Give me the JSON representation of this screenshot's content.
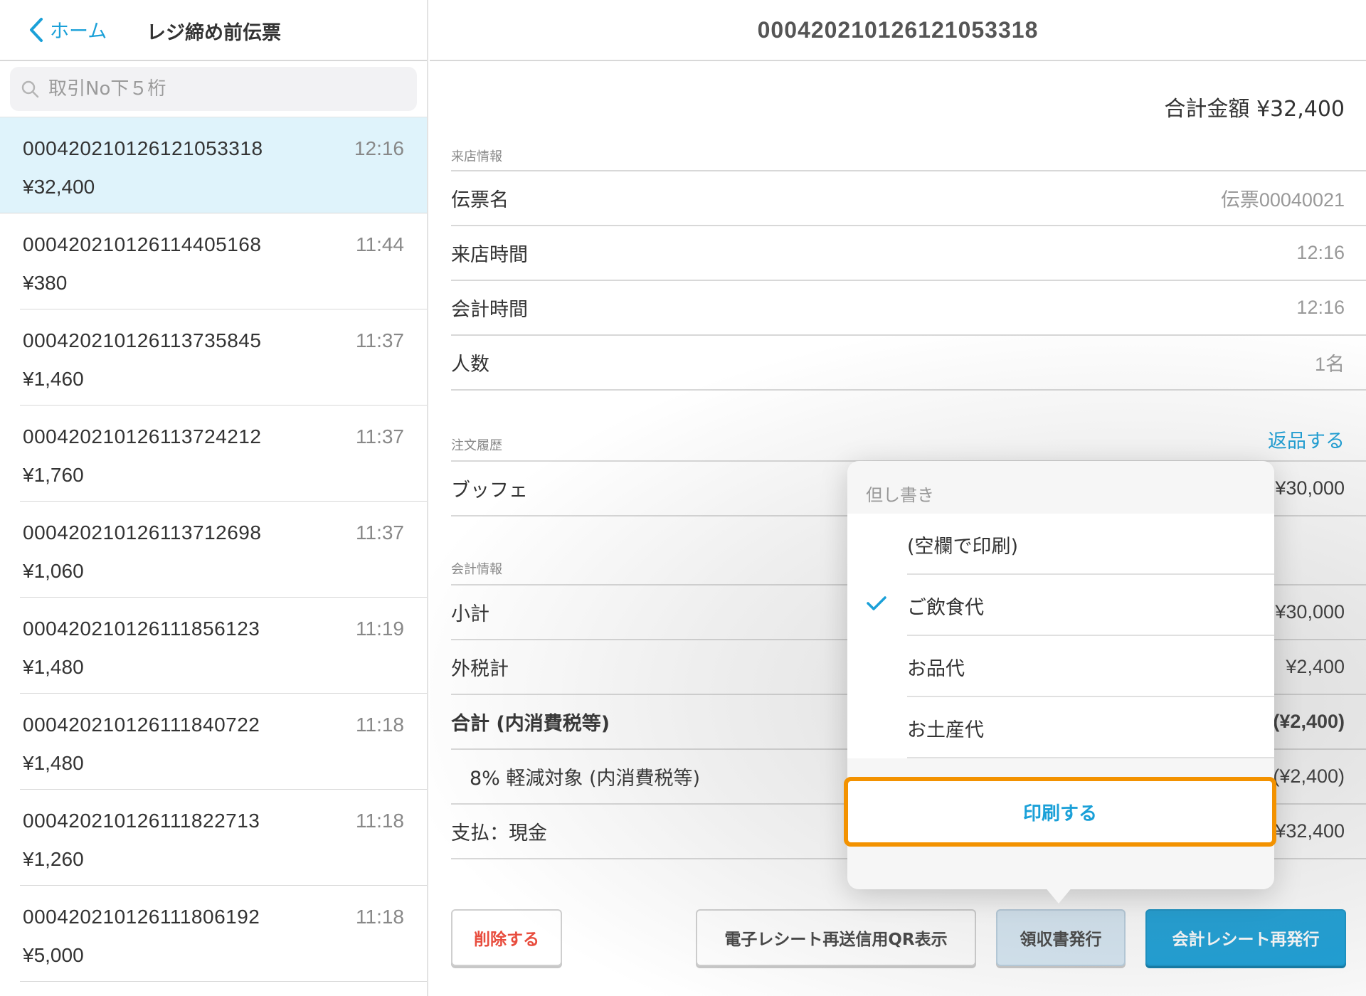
{
  "sidebar": {
    "back_label": "ホーム",
    "title": "レジ締め前伝票",
    "search_placeholder": "取引No下５桁",
    "slips": [
      {
        "no": "00042021012612105331 8",
        "amount": "¥32,400",
        "time": "12:16"
      },
      {
        "no": "000420210126114405168",
        "amount": "¥380",
        "time": "11:44"
      },
      {
        "no": "000420210126113735845",
        "amount": "¥1,460",
        "time": "11:37"
      },
      {
        "no": "000420210126113724212",
        "amount": "¥1,760",
        "time": "11:37"
      },
      {
        "no": "000420210126113712698",
        "amount": "¥1,060",
        "time": "11:37"
      },
      {
        "no": "000420210126111856123",
        "amount": "¥1,480",
        "time": "11:19"
      },
      {
        "no": "000420210126111840722",
        "amount": "¥1,480",
        "time": "11:18"
      },
      {
        "no": "000420210126111822713",
        "amount": "¥1,260",
        "time": "11:18"
      },
      {
        "no": "000420210126111806192",
        "amount": "¥5,000",
        "time": "11:18"
      }
    ]
  },
  "main": {
    "title": "000420210126121053318",
    "total_line": "合計金額 ¥32,400",
    "visit": {
      "label": "来店情報",
      "rows": [
        {
          "label": "伝票名",
          "value": "伝票00040021"
        },
        {
          "label": "来店時間",
          "value": "12:16"
        },
        {
          "label": "会計時間",
          "value": "12:16"
        },
        {
          "label": "人数",
          "value": "1名"
        }
      ]
    },
    "orders": {
      "label": "注文履歴",
      "return_link": "返品する",
      "rows": [
        {
          "label": "ブッフェ",
          "value": "¥30,000"
        }
      ]
    },
    "accounting": {
      "label": "会計情報",
      "rows": [
        {
          "label": "小計",
          "value": "¥30,000"
        },
        {
          "label": "外税計",
          "value": "¥2,400"
        },
        {
          "label": "合計 (内消費税等)",
          "value": "(¥2,400)"
        },
        {
          "label": "8% 軽減対象 (内消費税等)",
          "value": "(¥2,400)"
        },
        {
          "label": "支払：現金",
          "value": "¥32,400"
        }
      ]
    },
    "buttons": {
      "delete": "削除する",
      "qr": "電子レシート再送信用QR表示",
      "receipt": "領収書発行",
      "reissue": "会計レシート再発行"
    }
  },
  "popover": {
    "header": "但し書き",
    "options": [
      {
        "label": "(空欄で印刷)",
        "selected": false
      },
      {
        "label": "ご飲食代",
        "selected": true
      },
      {
        "label": "お品代",
        "selected": false
      },
      {
        "label": "お土産代",
        "selected": false
      }
    ],
    "print_label": "印刷する"
  },
  "colors": {
    "accent": "#1aa0d8",
    "selected_row": "#dff3fb",
    "danger": "#e84c3d",
    "highlight": "#f39200"
  }
}
